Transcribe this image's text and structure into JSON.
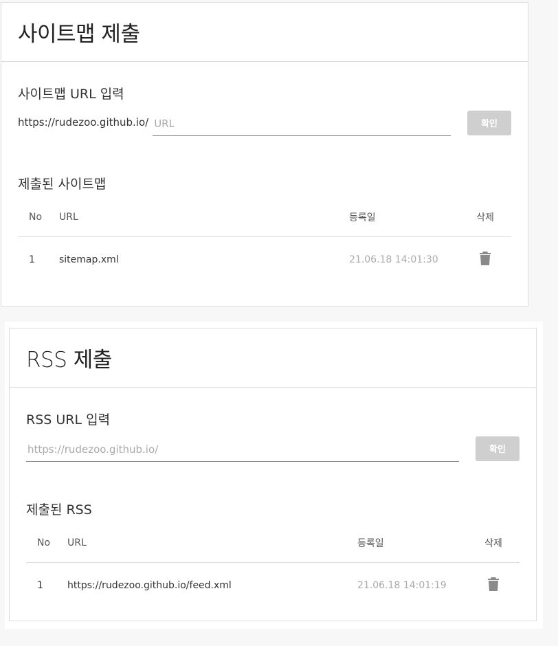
{
  "sitemap": {
    "title": "사이트맵 제출",
    "input_section_title": "사이트맵 URL 입력",
    "url_prefix": "https://rudezoo.github.io/",
    "input_placeholder": "URL",
    "confirm_label": "확인",
    "list_title": "제출된 사이트맵",
    "columns": {
      "no": "No",
      "url": "URL",
      "date": "등록일",
      "delete": "삭제"
    },
    "rows": [
      {
        "no": "1",
        "url": "sitemap.xml",
        "date": "21.06.18 14:01:30"
      }
    ]
  },
  "rss": {
    "title": "RSS 제출",
    "input_section_title": "RSS URL 입력",
    "input_placeholder": "https://rudezoo.github.io/",
    "confirm_label": "확인",
    "list_title": "제출된 RSS",
    "columns": {
      "no": "No",
      "url": "URL",
      "date": "등록일",
      "delete": "삭제"
    },
    "rows": [
      {
        "no": "1",
        "url": "https://rudezoo.github.io/feed.xml",
        "date": "21.06.18 14:01:19"
      }
    ]
  },
  "icons": {
    "delete": "trash-icon"
  },
  "colors": {
    "button_disabled": "#cfcfcf",
    "date_text": "#aaaaaa",
    "border": "#dcdcdc"
  }
}
